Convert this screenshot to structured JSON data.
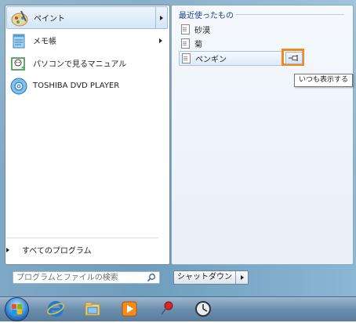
{
  "pinned_items": [
    {
      "label": "ペイント",
      "icon": "paint-palette-icon",
      "has_submenu": true,
      "selected": true
    },
    {
      "label": "メモ帳",
      "icon": "notepad-icon",
      "has_submenu": true,
      "selected": false
    },
    {
      "label": "パソコンで見るマニュアル",
      "icon": "manual-book-icon",
      "has_submenu": false,
      "selected": false
    },
    {
      "label": "TOSHIBA DVD PLAYER",
      "icon": "dvd-player-icon",
      "has_submenu": false,
      "selected": false
    }
  ],
  "all_programs": {
    "label": "すべてのプログラム"
  },
  "search": {
    "placeholder": "プログラムとファイルの検索"
  },
  "shutdown": {
    "label": "シャットダウン"
  },
  "recent": {
    "title": "最近使ったもの",
    "items": [
      {
        "label": "砂漠",
        "selected": false
      },
      {
        "label": "菊",
        "selected": false
      },
      {
        "label": "ペンギン",
        "selected": true
      }
    ]
  },
  "tooltip": {
    "text": "いつも表示する"
  },
  "taskbar": {
    "items": [
      "windows-start-orb-icon",
      "internet-explorer-icon",
      "file-explorer-icon",
      "media-player-icon",
      "pushpin-icon",
      "clock-icon"
    ]
  },
  "colors": {
    "highlight_box": "#f08a1d",
    "recent_title": "#1e3f8b"
  }
}
